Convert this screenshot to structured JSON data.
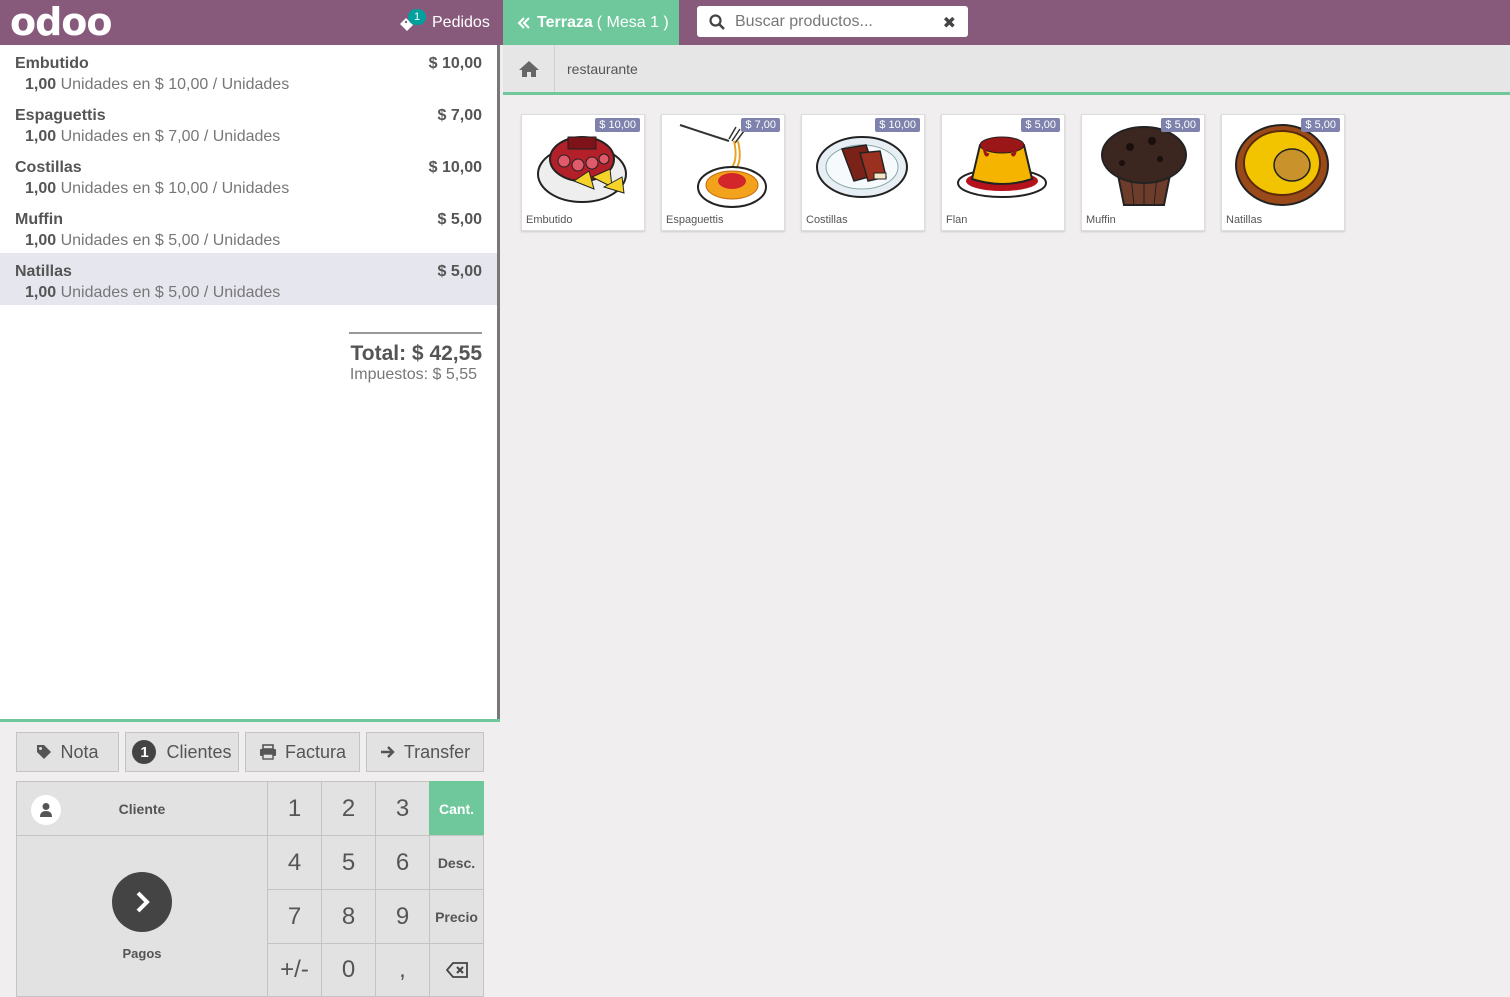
{
  "header": {
    "logo_text": "odoo",
    "orders_count": "1",
    "orders_label": "Pedidos",
    "table_floor": "Terraza",
    "table_name": "( Mesa 1 )",
    "search_placeholder": "Buscar productos...",
    "clear_icon": "✖"
  },
  "order": {
    "lines": [
      {
        "name": "Embutido",
        "price": "$ 10,00",
        "qty": "1,00",
        "info": "Unidades en $ 10,00 / Unidades"
      },
      {
        "name": "Espaguettis",
        "price": "$ 7,00",
        "qty": "1,00",
        "info": "Unidades en $ 7,00 / Unidades"
      },
      {
        "name": "Costillas",
        "price": "$ 10,00",
        "qty": "1,00",
        "info": "Unidades en $ 10,00 / Unidades"
      },
      {
        "name": "Muffin",
        "price": "$ 5,00",
        "qty": "1,00",
        "info": "Unidades en $ 5,00 / Unidades"
      },
      {
        "name": "Natillas",
        "price": "$ 5,00",
        "qty": "1,00",
        "info": "Unidades en $ 5,00 / Unidades",
        "selected": true
      }
    ],
    "total": "Total: $ 42,55",
    "taxes": "Impuestos: $ 5,55"
  },
  "controls": {
    "note": "Nota",
    "guests_count": "1",
    "guests": "Clientes",
    "invoice": "Factura",
    "transfer": "Transfer"
  },
  "numpad": {
    "customer": "Cliente",
    "payment": "Pagos",
    "keys": [
      "1",
      "2",
      "3",
      "4",
      "5",
      "6",
      "7",
      "8",
      "9",
      "+/-",
      "0",
      ","
    ],
    "modes": [
      "Cant.",
      "Desc.",
      "Precio"
    ],
    "backspace_icon": "backspace-icon"
  },
  "breadcrumb": {
    "home_icon": "home-icon",
    "category": "restaurante"
  },
  "products": [
    {
      "name": "Embutido",
      "price": "$ 10,00"
    },
    {
      "name": "Espaguettis",
      "price": "$ 7,00"
    },
    {
      "name": "Costillas",
      "price": "$ 10,00"
    },
    {
      "name": "Flan",
      "price": "$ 5,00"
    },
    {
      "name": "Muffin",
      "price": "$ 5,00"
    },
    {
      "name": "Natillas",
      "price": "$ 5,00"
    }
  ],
  "colors": {
    "brand": "#875a7b",
    "accent": "#6ec89b",
    "price_tag": "#7f82ac"
  }
}
